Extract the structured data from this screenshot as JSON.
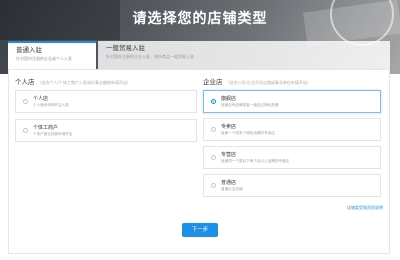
{
  "header": {
    "title": "请选择您的店铺类型"
  },
  "tabs": [
    {
      "label": "普通入驻",
      "desc": "针对国内注册的企业或个人入驻"
    },
    {
      "label": "一般贸易入驻",
      "desc": "针对国外注册的企业入驻，境外商品一般贸易入驻"
    }
  ],
  "personal": {
    "title": "个人店",
    "hint": "（适合个人/个体工商户入驻或在事业编制申请开店）",
    "options": [
      {
        "name": "个人店",
        "desc": "个人身份申请开店入驻"
      },
      {
        "name": "个体工商户",
        "desc": "个体户营业执照申请开店"
      }
    ]
  },
  "enterprise": {
    "title": "企业店",
    "hint": "（适合公司/企业开设店铺或事业单位申请开店）",
    "selected_index": 0,
    "options": [
      {
        "name": "旗舰店",
        "desc": "经营自有品牌或者一级独占授权品牌"
      },
      {
        "name": "专卖店",
        "desc": "经营一个或多个授权品牌的专卖店"
      },
      {
        "name": "专营店",
        "desc": "经营同一个类目下两个及以上品牌的专营店"
      },
      {
        "name": "普通店",
        "desc": "普通企业店铺"
      }
    ]
  },
  "help_link": "店铺类型和资质说明",
  "next_button": "下一步",
  "colors": {
    "accent": "#1e8fe6"
  }
}
